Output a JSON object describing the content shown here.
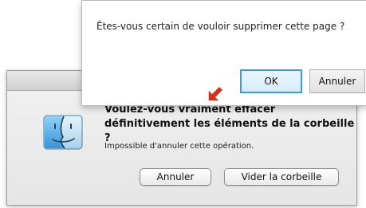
{
  "mac_dialog": {
    "title": "Voulez-vous vraiment effacer définitivement les éléments de la corbeille ?",
    "subtitle": "Impossible d'annuler cette opération.",
    "cancel_label": "Annuler",
    "empty_trash_label": "Vider la corbeille",
    "icon": "finder-icon"
  },
  "win_dialog": {
    "message": "Êtes-vous certain de vouloir supprimer cette page ?",
    "ok_label": "OK",
    "cancel_label": "Annuler",
    "ok_border_color": "#3c9be0"
  },
  "cursor": {
    "icon": "cursor-arrow-icon",
    "color": "#d0341f"
  }
}
